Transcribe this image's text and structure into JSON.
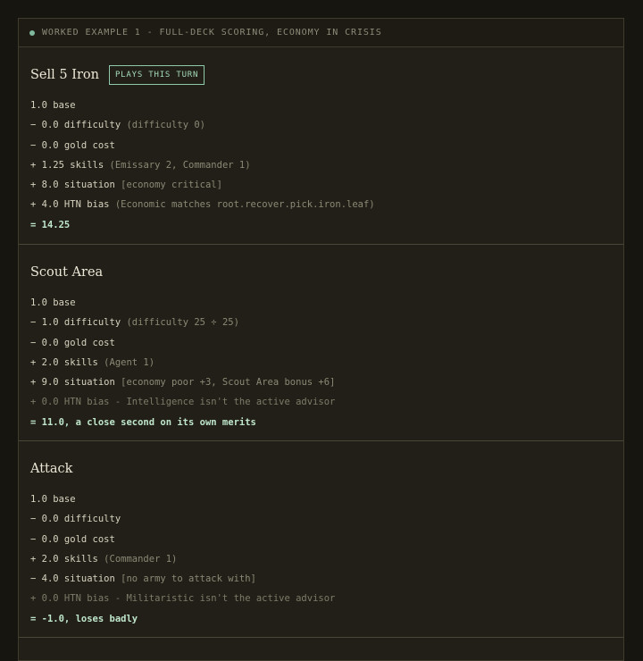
{
  "header": {
    "label": "WORKED EXAMPLE 1 - FULL-DECK SCORING, ECONOMY IN CRISIS"
  },
  "cards": [
    {
      "title": "Sell 5 Iron",
      "badge": "PLAYS THIS TURN",
      "lines": [
        {
          "main": "1.0 base",
          "note": ""
        },
        {
          "main": "− 0.0 difficulty",
          "note": " (difficulty 0)"
        },
        {
          "main": "− 0.0 gold cost",
          "note": ""
        },
        {
          "main": "+ 1.25 skills",
          "note": " (Emissary 2, Commander 1)"
        },
        {
          "main": "+ 8.0 situation",
          "note": " [economy critical]"
        },
        {
          "main": "+ 4.0 HTN bias",
          "note": " (Economic matches root.recover.pick.iron.leaf)"
        }
      ],
      "muted": "",
      "total": "= 14.25"
    },
    {
      "title": "Scout Area",
      "lines": [
        {
          "main": "1.0 base",
          "note": ""
        },
        {
          "main": "− 1.0 difficulty",
          "note": " (difficulty 25 ÷ 25)"
        },
        {
          "main": "− 0.0 gold cost",
          "note": ""
        },
        {
          "main": "+ 2.0 skills",
          "note": " (Agent 1)"
        },
        {
          "main": "+ 9.0 situation",
          "note": " [economy poor +3, Scout Area bonus +6]"
        }
      ],
      "muted": "+ 0.0 HTN bias - Intelligence isn't the active advisor",
      "total": "= 11.0, a close second on its own merits"
    },
    {
      "title": "Attack",
      "lines": [
        {
          "main": "1.0 base",
          "note": ""
        },
        {
          "main": "− 0.0 difficulty",
          "note": ""
        },
        {
          "main": "− 0.0 gold cost",
          "note": ""
        },
        {
          "main": "+ 2.0 skills",
          "note": " (Commander 1)"
        },
        {
          "main": "− 4.0 situation",
          "note": " [no army to attack with]"
        }
      ],
      "muted": "+ 0.0 HTN bias - Militaristic isn't the active advisor",
      "total": "= -1.0, loses badly"
    }
  ]
}
